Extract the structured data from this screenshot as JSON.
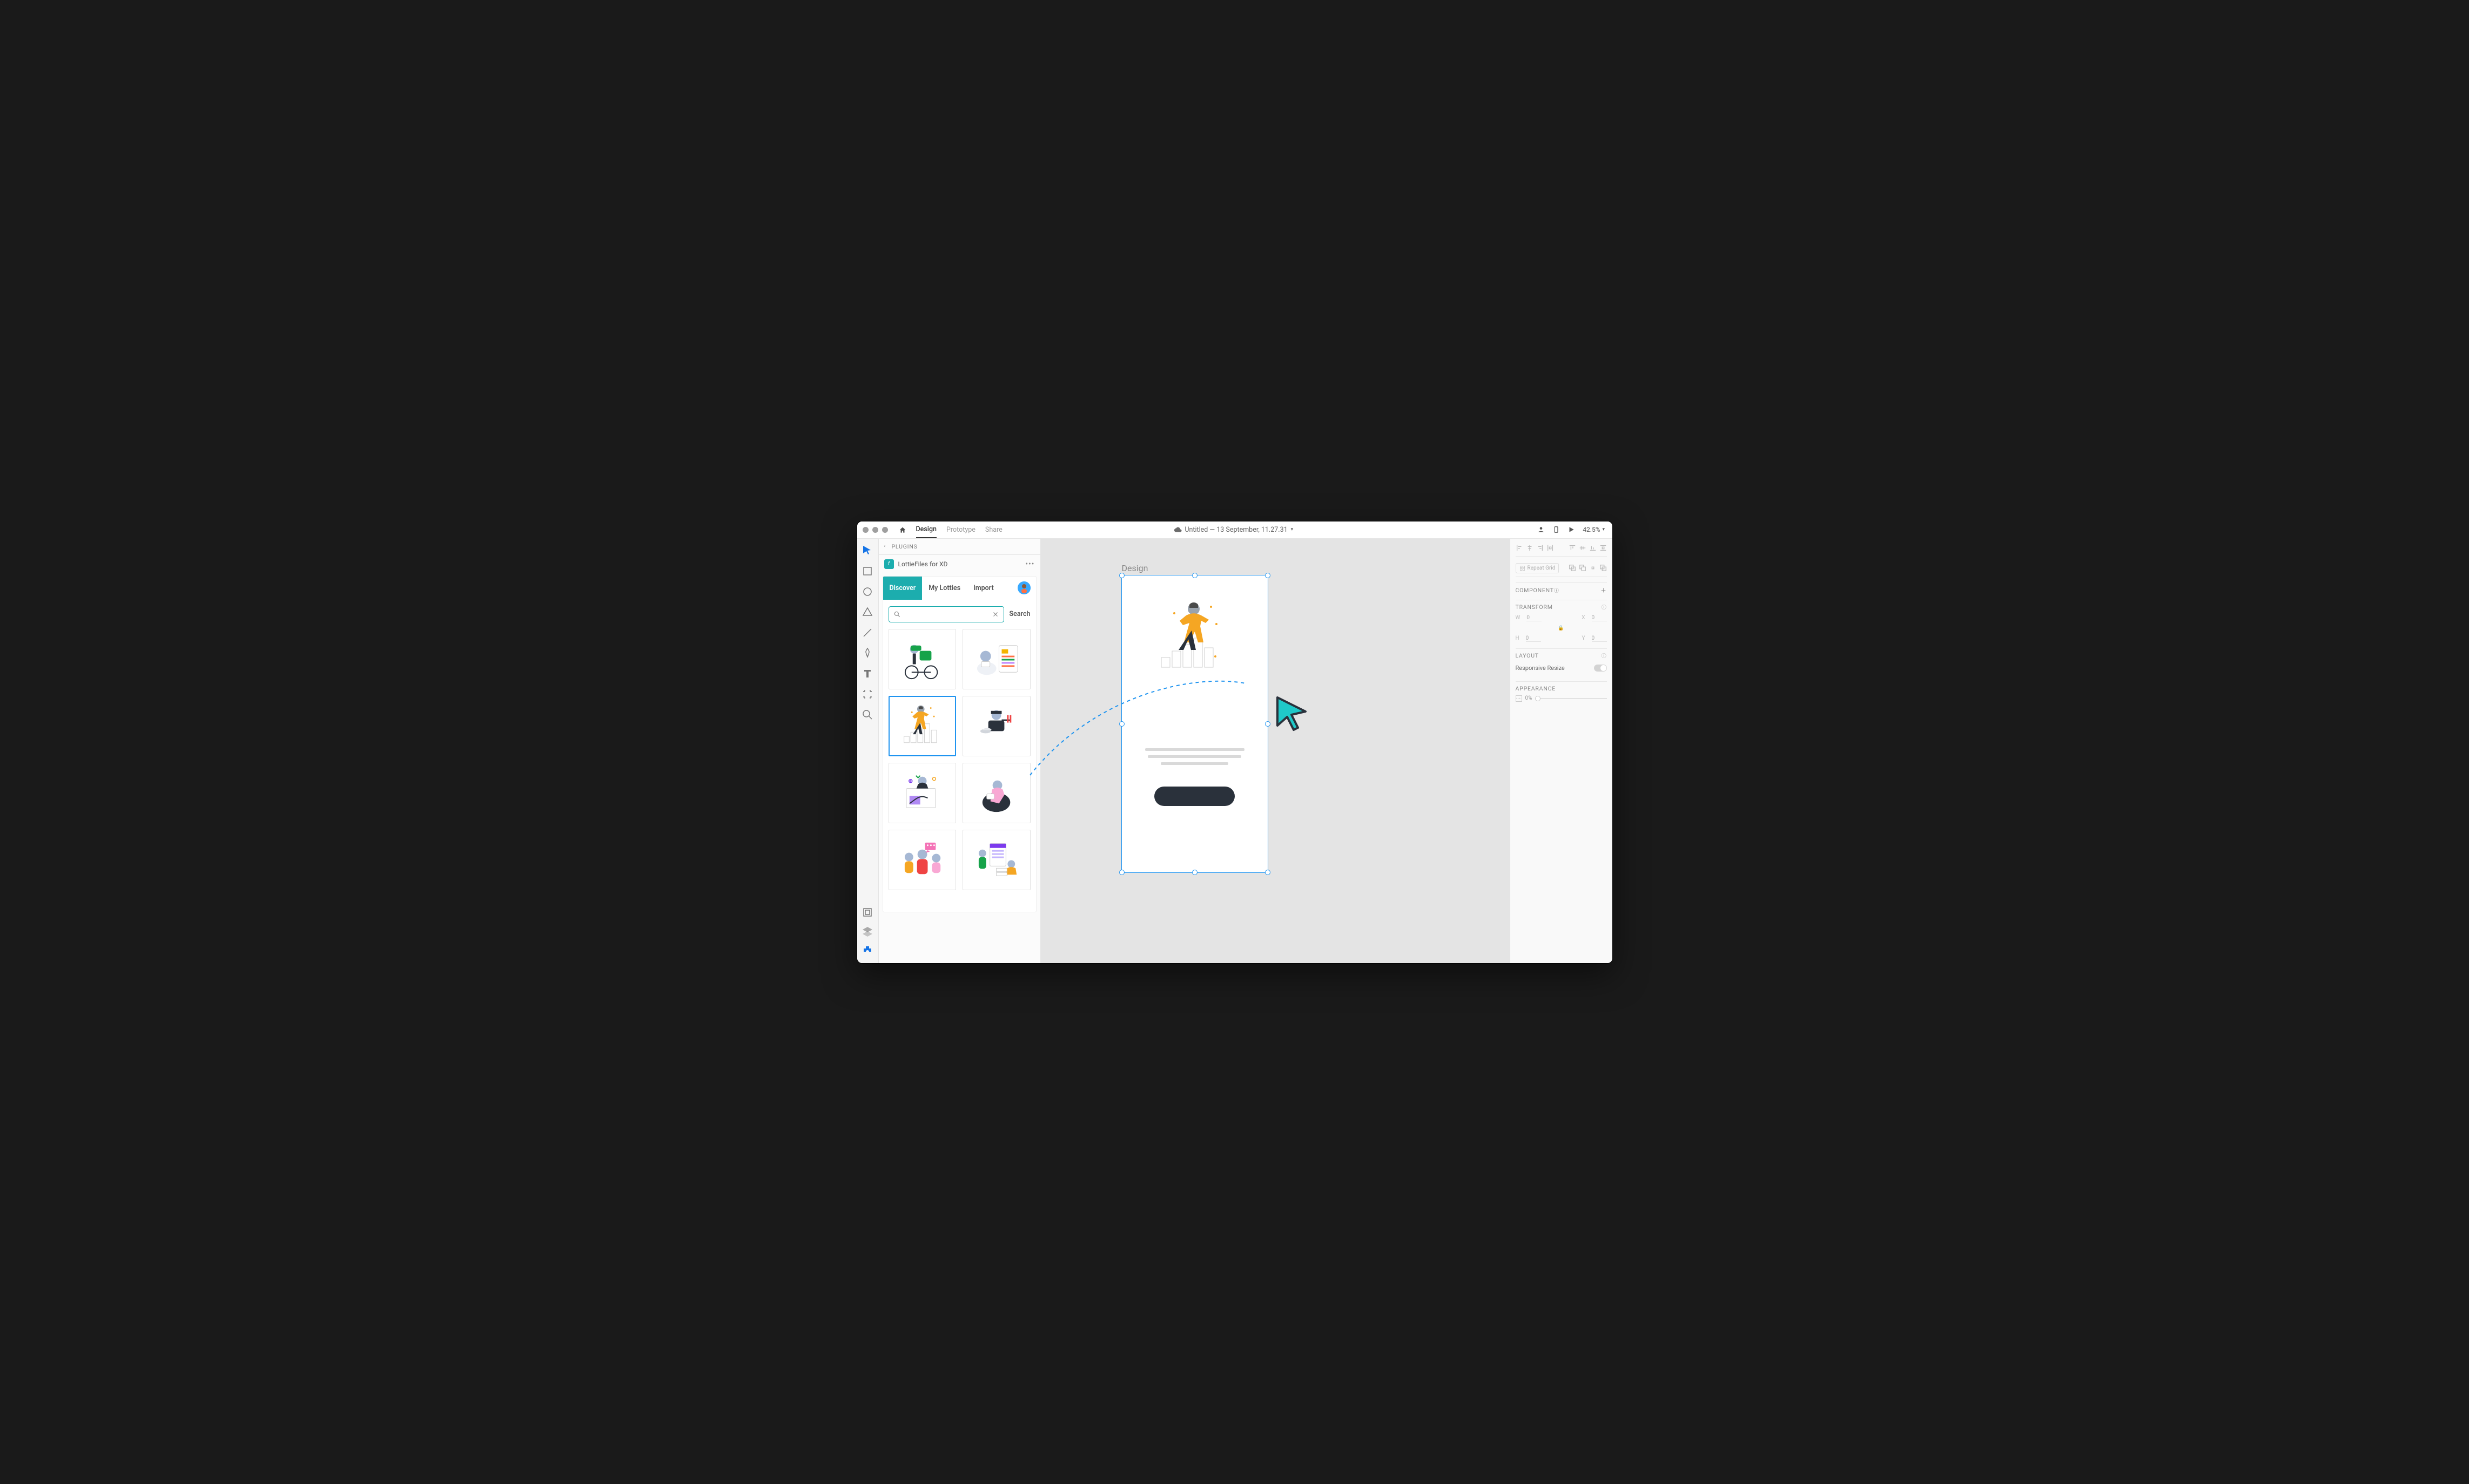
{
  "titlebar": {
    "tabs": {
      "design": "Design",
      "prototype": "Prototype",
      "share": "Share"
    },
    "doc_title": "Untitled — 13 September, 11.27.31",
    "zoom": "42.5%"
  },
  "panel": {
    "back_label": "PLUGINS",
    "plugin_name": "LottieFiles for XD",
    "lottie_tabs": {
      "discover": "Discover",
      "my": "My Lotties",
      "import": "Import"
    },
    "search_placeholder": "",
    "search_button": "Search"
  },
  "canvas": {
    "artboard_label": "Design"
  },
  "right": {
    "repeat_grid": "Repeat Grid",
    "component": "COMPONENT",
    "transform": "TRANSFORM",
    "layout": "LAYOUT",
    "responsive": "Responsive Resize",
    "appearance": "APPEARANCE",
    "opacity": "0%",
    "w": "0",
    "h": "0",
    "x": "0",
    "y": "0"
  }
}
